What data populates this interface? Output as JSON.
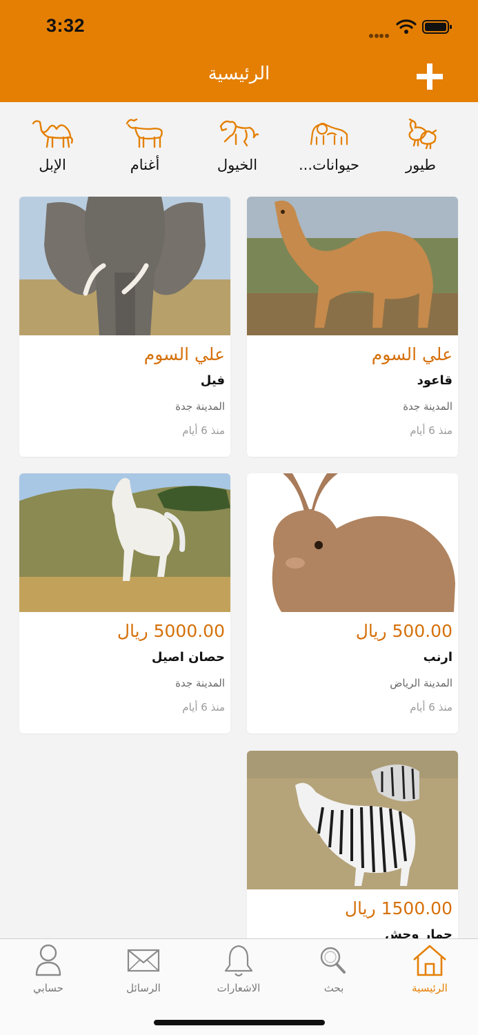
{
  "status_bar": {
    "time": "3:32"
  },
  "header": {
    "title": "الرئيسية"
  },
  "categories": [
    {
      "label": "طيور",
      "icon": "birds-icon"
    },
    {
      "label": "حيوانات...",
      "icon": "wild-animals-icon"
    },
    {
      "label": "الخيول",
      "icon": "horse-icon"
    },
    {
      "label": "أغنام",
      "icon": "goat-icon"
    },
    {
      "label": "الإبل",
      "icon": "camel-icon"
    }
  ],
  "listings": [
    {
      "price": "علي السوم",
      "name": "قاعود",
      "city": "المدينة جدة",
      "age": "منذ 6 أيام",
      "image": "camel-photo"
    },
    {
      "price": "علي السوم",
      "name": "فيل",
      "city": "المدينة جدة",
      "age": "منذ 6 أيام",
      "image": "elephant-photo"
    },
    {
      "price": "500.00 ريال",
      "name": "ارنب",
      "city": "المدينة الرياض",
      "age": "منذ 6 أيام",
      "image": "rabbit-photo"
    },
    {
      "price": "5000.00 ريال",
      "name": "حصان اصيل",
      "city": "المدينة جدة",
      "age": "منذ 6 أيام",
      "image": "horse-photo"
    },
    {
      "price": "1500.00 ريال",
      "name": "حمار وحش",
      "city": "",
      "age": "",
      "image": "zebra-photo"
    }
  ],
  "tabs": [
    {
      "label": "الرئيسية",
      "icon": "home-icon",
      "active": true
    },
    {
      "label": "بحث",
      "icon": "search-icon",
      "active": false
    },
    {
      "label": "الاشعارات",
      "icon": "bell-icon",
      "active": false
    },
    {
      "label": "الرسائل",
      "icon": "mail-icon",
      "active": false
    },
    {
      "label": "حسابي",
      "icon": "user-icon",
      "active": false
    }
  ],
  "colors": {
    "accent": "#e47f03",
    "price": "#d5700a",
    "background": "#f3f3f3"
  }
}
